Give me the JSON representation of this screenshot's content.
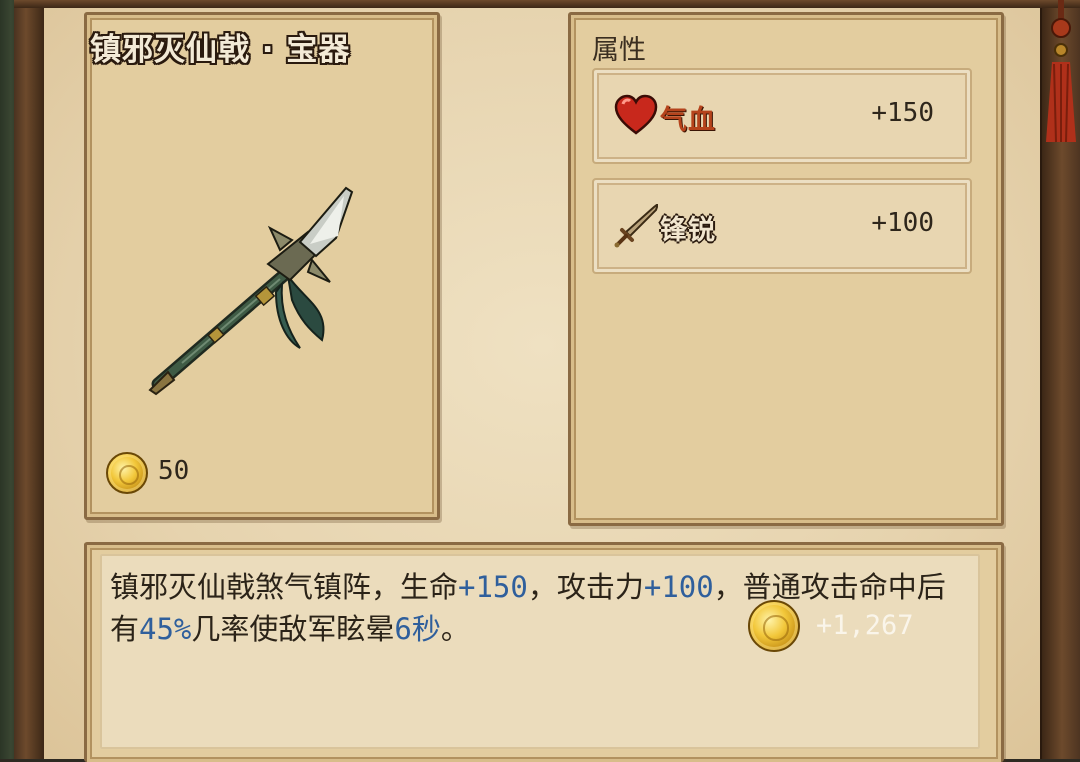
{
  "item": {
    "title": "镇邪灭仙戟 · 宝器",
    "price": "50",
    "price_icon": "gold-coin-icon",
    "image": "halberd-weapon-icon"
  },
  "attributes": {
    "header": "属性",
    "rows": [
      {
        "icon": "heart-icon",
        "name": "气血",
        "value": "+150"
      },
      {
        "icon": "sword-icon",
        "name": "锋锐",
        "value": "+100"
      }
    ]
  },
  "description": {
    "seg1": "镇邪灭仙戟煞气镇阵，生命",
    "hp_bonus": "+150",
    "seg2": "，攻击力",
    "atk_bonus": "+100",
    "seg3": "，普通攻击命中后有",
    "chance": "45%",
    "seg4": "几率使敌军眩晕",
    "duration": "6秒",
    "seg5": "。",
    "sell_value": "+1,267",
    "sell_icon": "gold-coin-icon"
  },
  "colors": {
    "parchment": "#e6d3ae",
    "highlight_blue": "#2f5f9c",
    "hp_red": "#b5431c",
    "frame_brown": "#6d4a2c"
  }
}
